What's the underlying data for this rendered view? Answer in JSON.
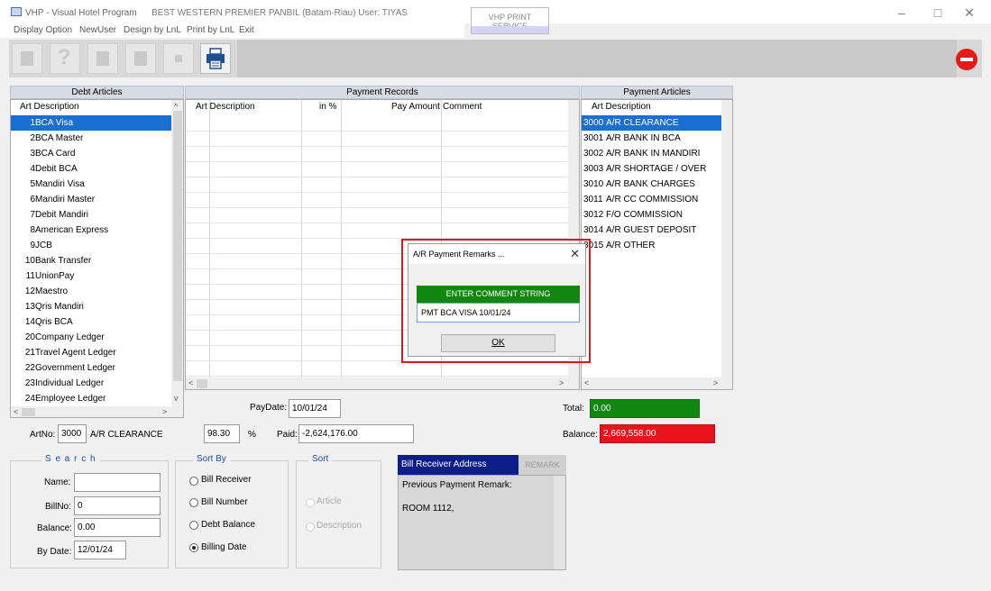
{
  "window": {
    "title": "VHP - Visual Hotel Program",
    "hotel_user": "BEST WESTERN PREMIER PANBIL (Batam-Riau) User: TIYAS",
    "print_service": "VHP PRINT SERVICE",
    "minimize": "–",
    "maximize": "□",
    "close": "✕"
  },
  "menu": [
    "Display Option",
    "NewUser",
    "Design by LnL",
    "Print by LnL",
    "Exit"
  ],
  "debt_articles": {
    "title": "Debt Articles",
    "column": "Art Description",
    "items": [
      {
        "no": "1",
        "desc": "BCA Visa"
      },
      {
        "no": "2",
        "desc": "BCA Master"
      },
      {
        "no": "3",
        "desc": "BCA Card"
      },
      {
        "no": "4",
        "desc": "Debit BCA"
      },
      {
        "no": "5",
        "desc": "Mandiri Visa"
      },
      {
        "no": "6",
        "desc": "Mandiri Master"
      },
      {
        "no": "7",
        "desc": "Debit Mandiri"
      },
      {
        "no": "8",
        "desc": "American Express"
      },
      {
        "no": "9",
        "desc": "JCB"
      },
      {
        "no": "10",
        "desc": "Bank Transfer"
      },
      {
        "no": "11",
        "desc": "UnionPay"
      },
      {
        "no": "12",
        "desc": "Maestro"
      },
      {
        "no": "13",
        "desc": "Qris Mandiri"
      },
      {
        "no": "14",
        "desc": "Qris BCA"
      },
      {
        "no": "20",
        "desc": "Company Ledger"
      },
      {
        "no": "21",
        "desc": "Travel Agent Ledger"
      },
      {
        "no": "22",
        "desc": "Government Ledger"
      },
      {
        "no": "23",
        "desc": "Individual Ledger"
      },
      {
        "no": "24",
        "desc": "Employee Ledger"
      }
    ]
  },
  "payment_records": {
    "title": "Payment Records",
    "columns": [
      "Art Description",
      "in %",
      "Pay Amount",
      "Comment"
    ]
  },
  "payment_articles": {
    "title": "Payment Articles",
    "column": "Art Description",
    "items": [
      {
        "no": "3000",
        "desc": "A/R CLEARANCE"
      },
      {
        "no": "3001",
        "desc": "A/R BANK IN BCA"
      },
      {
        "no": "3002",
        "desc": "A/R BANK IN MANDIRI"
      },
      {
        "no": "3003",
        "desc": "A/R SHORTAGE / OVER"
      },
      {
        "no": "3010",
        "desc": "A/R BANK CHARGES"
      },
      {
        "no": "3011",
        "desc": "A/R CC COMMISSION"
      },
      {
        "no": "3012",
        "desc": "F/O COMMISSION"
      },
      {
        "no": "3014",
        "desc": "A/R GUEST DEPOSIT"
      },
      {
        "no": "3015",
        "desc": "A/R OTHER"
      }
    ]
  },
  "form": {
    "artno_label": "ArtNo:",
    "artno": "3000",
    "art_desc": "A/R CLEARANCE",
    "paydate_label": "PayDate:",
    "paydate": "10/01/24",
    "percent": "98.30",
    "percent_sign": "%",
    "paid_label": "Paid:",
    "paid": "-2,624,176.00",
    "total_label": "Total:",
    "total": "0.00",
    "balance_label": "Balance:",
    "balance": "2,669,558.00"
  },
  "search": {
    "legend": "S e a r c h",
    "name_label": "Name:",
    "name": "",
    "billno_label": "BillNo:",
    "billno": "0",
    "balance_label": "Balance:",
    "balance": "0.00",
    "bydate_label": "By Date:",
    "bydate": "12/01/24"
  },
  "sort_by": {
    "legend": "Sort By",
    "options": [
      "Bill Receiver",
      "Bill Number",
      "Debt Balance",
      "Billing Date"
    ],
    "selected": "Billing Date"
  },
  "sort": {
    "legend": "Sort",
    "options": [
      "Article",
      "Description"
    ]
  },
  "bill_receiver": {
    "tab_address": "Bill Receiver Address",
    "tab_remark": "REMARK",
    "remark_label": "Previous Payment Remark:",
    "remark": "ROOM 1112,"
  },
  "dialog": {
    "title": "A/R Payment Remarks ...",
    "close": "✕",
    "header": "ENTER COMMENT STRING",
    "value": "PMT BCA VISA 10/01/24",
    "ok": "OK"
  }
}
